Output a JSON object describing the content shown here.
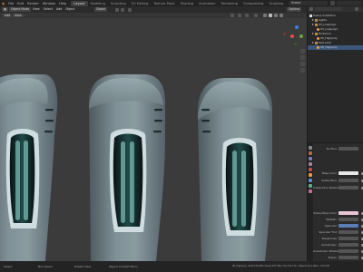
{
  "menu": [
    "File",
    "Edit",
    "Render",
    "Window",
    "Help"
  ],
  "workspace_tabs": [
    "Layout",
    "Modeling",
    "Sculpting",
    "UV Editing",
    "Texture Paint",
    "Shading",
    "Animation",
    "Rendering",
    "Compositing",
    "Scripting"
  ],
  "active_tab": "Layout",
  "scene_name": "Scene",
  "viewport_header": {
    "mode": "Object Mode",
    "view": "View",
    "select": "Select",
    "add": "Add",
    "object": "Object",
    "orientation": "Global",
    "options": "Options"
  },
  "viewport_tools": {
    "add_label": "Add",
    "view_label": "View"
  },
  "outliner": {
    "root": "Scene Collection",
    "rows": [
      {
        "label": "Lights",
        "type": "collection",
        "indent": 1
      },
      {
        "label": "03_LowpolyL",
        "type": "collection",
        "indent": 1
      },
      {
        "label": "03_LowpolyL",
        "type": "object",
        "indent": 2
      },
      {
        "label": "Hinterion",
        "type": "collection",
        "indent": 1
      },
      {
        "label": "05_Highpoly",
        "type": "object",
        "indent": 2
      },
      {
        "label": "Fast pack",
        "type": "collection",
        "indent": 1
      },
      {
        "label": "08_Highpoly",
        "type": "object",
        "indent": 2,
        "selected": true
      }
    ]
  },
  "properties": {
    "header": "Surface",
    "rows": [
      {
        "label": "Surface",
        "kind": "header"
      },
      {
        "label": "Base Color",
        "kind": "color"
      },
      {
        "label": "Subsurface",
        "kind": "value"
      },
      {
        "label": "Subsurface Radius",
        "kind": "value"
      },
      {
        "label": "Subsurface Color",
        "kind": "pink"
      },
      {
        "label": "Metallic",
        "kind": "value"
      },
      {
        "label": "Specular",
        "kind": "bar"
      },
      {
        "label": "Specular Tint",
        "kind": "value"
      },
      {
        "label": "Roughness",
        "kind": "value"
      },
      {
        "label": "Anisotropic",
        "kind": "value"
      },
      {
        "label": "Anisotropic Rotation",
        "kind": "value"
      },
      {
        "label": "Sheen",
        "kind": "value"
      }
    ]
  },
  "status": {
    "left": "Select",
    "middle1": "Box Select",
    "middle2": "Rotate View",
    "middle3": "Object Context Menu",
    "right": "08_Highpoly | Verts:159,448 | Faces:157,356 | Tris:314,712 | Objects:1/4 | Mem: 1.02 GiB"
  },
  "colors": {
    "selected_row": "#3d5578",
    "gizmo_x": "#e14d52",
    "gizmo_y": "#6ca63a",
    "gizmo_z": "#3f7fd9"
  }
}
